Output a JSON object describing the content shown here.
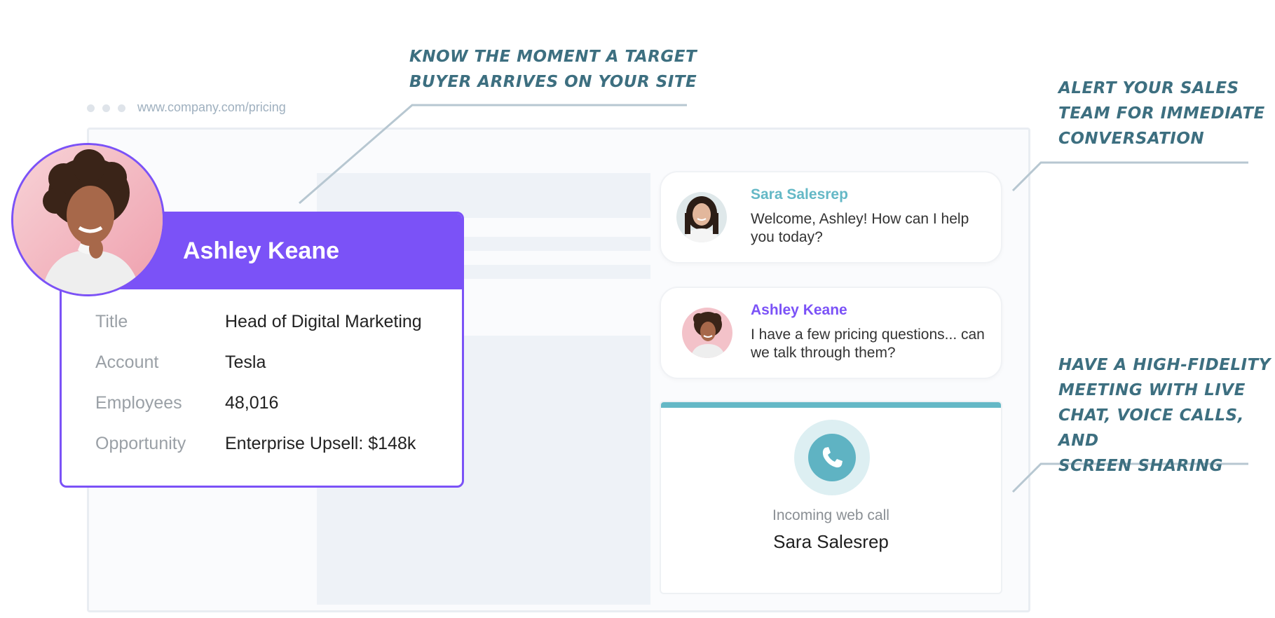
{
  "browser": {
    "url": "www.company.com/pricing"
  },
  "annotations": {
    "top": [
      "Know the moment a target",
      "buyer arrives on your site"
    ],
    "right_top": [
      "Alert your sales",
      "team for immediate",
      "conversation"
    ],
    "right_bottom": [
      "Have a high-fidelity",
      "meeting with live",
      "chat, voice calls, and",
      "screen sharing"
    ]
  },
  "profile": {
    "name": "Ashley Keane",
    "rows": [
      {
        "label": "Title",
        "value": "Head of Digital Marketing"
      },
      {
        "label": "Account",
        "value": "Tesla"
      },
      {
        "label": "Employees",
        "value": "48,016"
      },
      {
        "label": "Opportunity",
        "value": "Enterprise Upsell: $148k"
      }
    ]
  },
  "chat": {
    "messages": [
      {
        "sender": "Sara Salesrep",
        "text": "Welcome, Ashley! How can I help you today?"
      },
      {
        "sender": "Ashley Keane",
        "text": "I have a few pricing questions... can we talk through them?"
      }
    ]
  },
  "call": {
    "label": "Incoming web call",
    "caller": "Sara Salesrep",
    "icon": "phone-icon"
  },
  "colors": {
    "purple": "#7b52f7",
    "teal": "#5fb3c3",
    "annotation": "#3d6f80"
  }
}
